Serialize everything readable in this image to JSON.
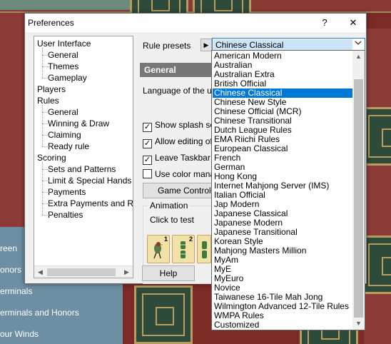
{
  "window": {
    "title": "Preferences",
    "help_glyph": "?",
    "close_glyph": "✕"
  },
  "tree": [
    {
      "label": "User Interface",
      "level": 0
    },
    {
      "label": "General",
      "level": 1
    },
    {
      "label": "Themes",
      "level": 1
    },
    {
      "label": "Gameplay",
      "level": 1
    },
    {
      "label": "Players",
      "level": 0
    },
    {
      "label": "Rules",
      "level": 0
    },
    {
      "label": "General",
      "level": 1
    },
    {
      "label": "Winning & Draw",
      "level": 1
    },
    {
      "label": "Claiming",
      "level": 1
    },
    {
      "label": "Ready rule",
      "level": 1
    },
    {
      "label": "Scoring",
      "level": 0
    },
    {
      "label": "Sets and Patterns",
      "level": 1
    },
    {
      "label": "Limit & Special Hands",
      "level": 1
    },
    {
      "label": "Payments",
      "level": 1
    },
    {
      "label": "Extra Payments and Rou",
      "level": 1
    },
    {
      "label": "Penalties",
      "level": 1
    }
  ],
  "presets": {
    "label": "Rule presets",
    "button_glyph": "▶",
    "selected": "Chinese Classical",
    "chevron": "⌵"
  },
  "section": {
    "title": "General",
    "language_label": "Language of the use"
  },
  "checkboxes": [
    {
      "label": "Show splash scre",
      "checked": true
    },
    {
      "label": "Allow editing of h",
      "checked": true
    },
    {
      "label": "Leave Taskbar",
      "checked": true
    },
    {
      "label": "Use color manag",
      "checked": false
    }
  ],
  "game_controls_label": "Game Controls...",
  "animation": {
    "legend": "Animation",
    "click_label": "Click to test",
    "tile_numbers": [
      "1",
      "2",
      ""
    ]
  },
  "help_label": "Help",
  "dropdown": {
    "options": [
      "American Modern",
      "Australian",
      "Australian Extra",
      "British Official",
      "Chinese Classical",
      "Chinese New Style",
      "Chinese Official (MCR)",
      "Chinese Transitional",
      "Dutch League Rules",
      "EMA Riichi Rules",
      "European Classical",
      "French",
      "German",
      "Hong Kong",
      "Internet Mahjong Server (IMS)",
      "Italian Official",
      "Jap Modern",
      "Japanese Classical",
      "Japanese Modern",
      "Japanese Transitional",
      "Korean Style",
      "Mahjong Masters Million",
      "MyAm",
      "MyE",
      "MyEuro",
      "Novice",
      "Taiwanese 16-Tile Mah Jong",
      "Wilmington Advanced 12-Tile Rules",
      "WMPA Rules",
      "Customized"
    ],
    "selected_index": 4,
    "scroll_up_glyph": "▲",
    "scroll_down_glyph": "▼"
  },
  "background": {
    "left_list": [
      "reen",
      "onors",
      "erminals",
      "erminals and Honors",
      "our Winds"
    ]
  },
  "colors": {
    "selection": "#0078d7",
    "section_header": "#787878",
    "background_red": "#7b2a26",
    "background_blue": "#6d8ea3"
  }
}
